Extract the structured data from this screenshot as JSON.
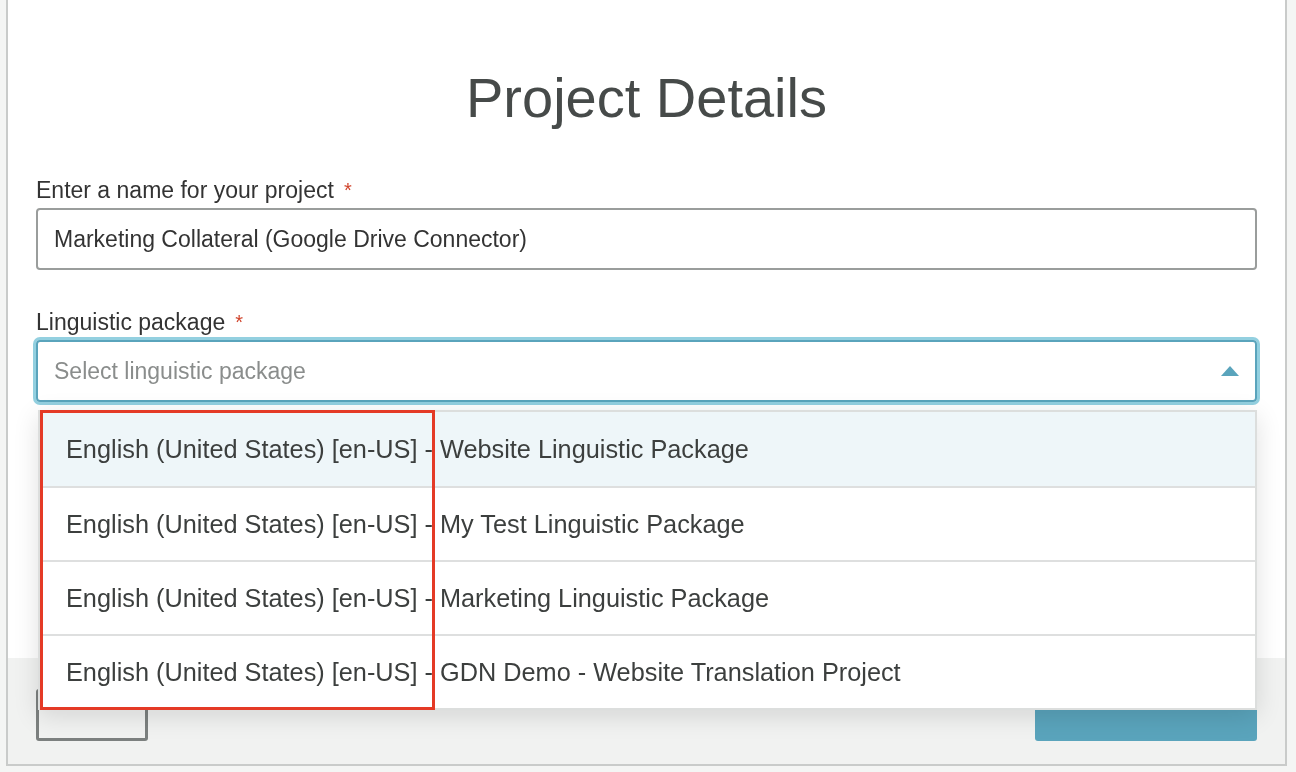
{
  "dialog": {
    "title": "Project Details"
  },
  "fields": [
    {
      "label": "Enter a name for your project",
      "required_mark": "*",
      "value": "Marketing Collateral (Google Drive Connector)",
      "focused": false
    },
    {
      "label": "Linguistic package",
      "required_mark": "*",
      "placeholder": "Select linguistic package",
      "focused": true,
      "expanded": true
    }
  ],
  "dropdown_options": [
    {
      "label": "English (United States) [en-US] - Website Linguistic Package",
      "selected": true
    },
    {
      "label": "English (United States) [en-US] - My Test Linguistic Package",
      "selected": false
    },
    {
      "label": "English (United States) [en-US] - Marketing Linguistic Package",
      "selected": false
    },
    {
      "label": "English (United States) [en-US] - GDN Demo - Website Translation Project",
      "selected": false
    }
  ]
}
